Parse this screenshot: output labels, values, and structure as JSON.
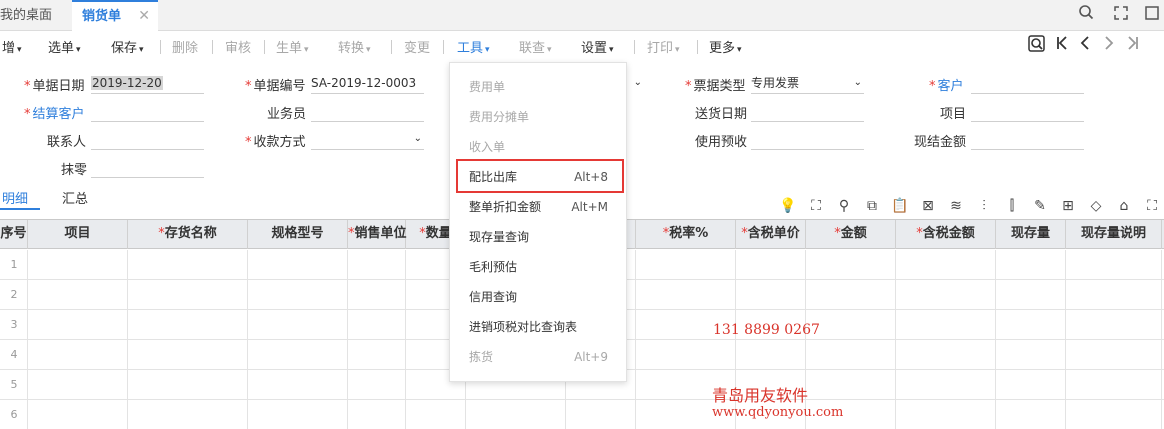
{
  "tabs": {
    "home": "我的桌面",
    "active": "销货单",
    "close": "✕"
  },
  "window_icons": [
    "search-icon",
    "restore-icon",
    "close-icon"
  ],
  "toolbar": {
    "items": [
      {
        "label": "增",
        "state": "normal",
        "caret": true
      },
      {
        "label": "选单",
        "state": "normal",
        "caret": true
      },
      {
        "label": "保存",
        "state": "normal",
        "caret": true
      },
      {
        "label": "删除",
        "state": "disabled",
        "caret": false
      },
      {
        "label": "审核",
        "state": "disabled",
        "caret": false
      },
      {
        "label": "生单",
        "state": "disabled",
        "caret": true
      },
      {
        "label": "转换",
        "state": "disabled",
        "caret": true
      },
      {
        "label": "变更",
        "state": "disabled",
        "caret": false
      },
      {
        "label": "工具",
        "state": "active",
        "caret": true
      },
      {
        "label": "联查",
        "state": "disabled",
        "caret": true
      },
      {
        "label": "设置",
        "state": "normal",
        "caret": true
      },
      {
        "label": "打印",
        "state": "disabled",
        "caret": true
      },
      {
        "label": "更多",
        "state": "normal",
        "caret": true
      }
    ],
    "nav_icons": [
      "magnify-icon",
      "first-record-icon",
      "prev-record-icon",
      "next-record-icon",
      "last-record-icon"
    ]
  },
  "form": {
    "date_label": "单据日期",
    "date_value": "2019-12-20",
    "code_label": "单据编号",
    "code_value": "SA-2019-12-0003",
    "invoice_type_label": "票据类型",
    "invoice_type_value": "专用发票",
    "customer_label": "客户",
    "customer_value": "",
    "settle_customer_label": "结算客户",
    "settle_customer_value": "",
    "salesman_label": "业务员",
    "salesman_value": "",
    "ship_date_label": "送货日期",
    "ship_date_value": "",
    "project_label": "项目",
    "project_value": "",
    "contact_label": "联系人",
    "contact_value": "",
    "payment_label": "收款方式",
    "payment_value": "",
    "advance_label": "使用预收",
    "advance_value": "",
    "cash_label": "现结金额",
    "cash_value": "",
    "rounding_label": "抹零",
    "rounding_value": ""
  },
  "subtabs": {
    "detail": "明细",
    "summary": "汇总"
  },
  "right_icons": [
    "bulb-icon",
    "scan-icon",
    "location-icon",
    "copy-icon",
    "paste-icon",
    "delete-row-icon",
    "format-icon",
    "split-icon",
    "chart-icon",
    "edit-icon",
    "grid-icon",
    "tag-icon",
    "house-icon",
    "fullscreen-icon"
  ],
  "grid": {
    "columns": [
      {
        "label": "序号",
        "req": false
      },
      {
        "label": "项目",
        "req": false
      },
      {
        "label": "存货名称",
        "req": true
      },
      {
        "label": "规格型号",
        "req": false
      },
      {
        "label": "销售单位",
        "req": true
      },
      {
        "label": "数量",
        "req": true
      },
      {
        "label": "",
        "req": false
      },
      {
        "label": "",
        "req": false
      },
      {
        "label": "税率%",
        "req": true
      },
      {
        "label": "含税单价",
        "req": true
      },
      {
        "label": "金额",
        "req": true
      },
      {
        "label": "含税金额",
        "req": true
      },
      {
        "label": "现存量",
        "req": false
      },
      {
        "label": "现存量说明",
        "req": false
      }
    ],
    "rows": [
      "1",
      "2",
      "3",
      "4",
      "5",
      "6"
    ]
  },
  "tools_menu": {
    "items": [
      {
        "label": "费用单",
        "shortcut": "",
        "disabled": true
      },
      {
        "label": "费用分摊单",
        "shortcut": "",
        "disabled": true
      },
      {
        "label": "收入单",
        "shortcut": "",
        "disabled": true
      },
      {
        "label": "配比出库",
        "shortcut": "Alt+8",
        "disabled": false
      },
      {
        "label": "整单折扣金额",
        "shortcut": "Alt+M",
        "disabled": false
      },
      {
        "label": "现存量查询",
        "shortcut": "",
        "disabled": false
      },
      {
        "label": "毛利预估",
        "shortcut": "",
        "disabled": false
      },
      {
        "label": "信用查询",
        "shortcut": "",
        "disabled": false
      },
      {
        "label": "进销项税对比查询表",
        "shortcut": "",
        "disabled": false
      },
      {
        "label": "拣货",
        "shortcut": "Alt+9",
        "disabled": true
      }
    ]
  },
  "watermark": {
    "phone": "131 8899 0267",
    "company": "青岛用友软件",
    "url": "www.qdyonyou.com"
  },
  "colors": {
    "accent": "#2f7fdc",
    "required": "#e53935",
    "highlight_border": "#e53935",
    "watermark": "#d9342b"
  }
}
